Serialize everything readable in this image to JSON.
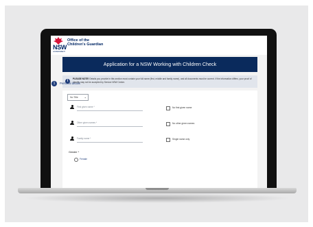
{
  "org": {
    "logo_text": "NSW",
    "logo_subtext": "GOVERNMENT",
    "name": "Office of the\nChildren's Guardian"
  },
  "page": {
    "title": "Application for a NSW Working with Children Check"
  },
  "notice": {
    "icon": "info-icon",
    "label": "PLEASE NOTE!",
    "text": " Details you provide in this section must contain your full name (first, middle and family name), and all documents must be current. If the information differs, your proof of identity may not be accepted by Service NSW Centre."
  },
  "section": {
    "number": "1",
    "title": "Personal details"
  },
  "form": {
    "title_select": {
      "value": "No Title"
    },
    "first_given_name": {
      "placeholder": "First given name *",
      "checkbox_label": "No first given name"
    },
    "other_given_names": {
      "placeholder": "Other given names *",
      "checkbox_label": "No other given names"
    },
    "family_name": {
      "placeholder": "Family name *",
      "checkbox_label": "Single name only"
    },
    "gender": {
      "label": "Gender *",
      "options": [
        "Female"
      ]
    }
  },
  "colors": {
    "header_navy": "#0a2a5c",
    "brand_red": "#d7153a",
    "brand_blue": "#002664"
  }
}
